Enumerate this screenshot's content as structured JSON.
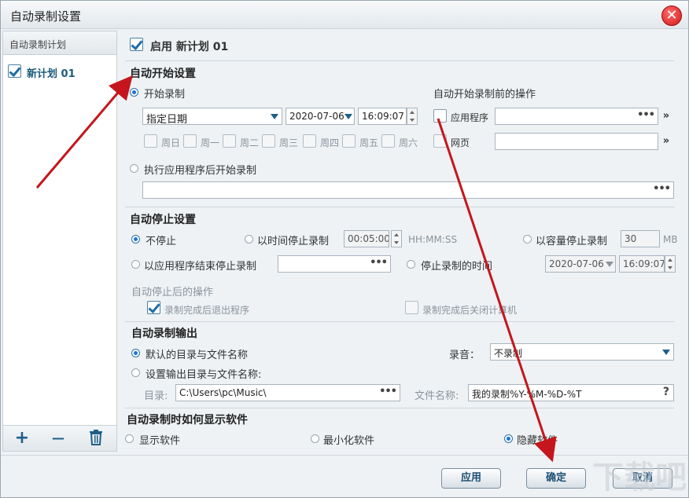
{
  "window": {
    "title": "自动录制设置",
    "close_symbol": "✕"
  },
  "left": {
    "header": "自动录制计划",
    "items": [
      {
        "label": "新计划 01",
        "checked": true
      }
    ]
  },
  "enable_label": "启用 新计划 01",
  "auto_start": {
    "title": "自动开始设置",
    "start_record_label": "开始录制",
    "date_mode": "指定日期",
    "date": "2020-07-06",
    "time": "16:09:07",
    "weekdays": [
      "周日",
      "周一",
      "周二",
      "周三",
      "周四",
      "周五",
      "周六"
    ],
    "after_app_label": "执行应用程序后开始录制",
    "pre_actions_title": "自动开始录制前的操作",
    "app_label": "应用程序",
    "web_label": "网页",
    "dots": "•••",
    "go_symbol": "»"
  },
  "auto_stop": {
    "title": "自动停止设置",
    "no_stop_label": "不停止",
    "by_time_label": "以时间停止录制",
    "time_value": "00:05:00",
    "time_unit": "HH:MM:SS",
    "by_size_label": "以容量停止录制",
    "size_value": "30",
    "size_unit": "MB",
    "by_app_end_label": "以应用程序结束停止录制",
    "stop_time_label": "停止录制的时间",
    "stop_date": "2020-07-06",
    "stop_time": "16:09:07",
    "after_stop_title": "自动停止后的操作",
    "exit_program_label": "录制完成后退出程序",
    "shutdown_label": "录制完成后关闭计算机"
  },
  "output": {
    "title": "自动录制输出",
    "default_label": "默认的目录与文件名称",
    "audio_label": "录音：",
    "audio_value": "不录制",
    "custom_label": "设置输出目录与文件名称:",
    "dir_label": "目录:",
    "dir_value": "C:\\Users\\pc\\Music\\",
    "filename_label": "文件名称:",
    "filename_value": "我的录制%Y-%M-%D-%T",
    "help_symbol": "?"
  },
  "display": {
    "title": "自动录制时如何显示软件",
    "show_label": "显示软件",
    "minimize_label": "最小化软件",
    "hide_label": "隐藏软件"
  },
  "buttons": {
    "apply": "应用",
    "ok": "确定",
    "cancel": "取消"
  },
  "left_toolbar": {
    "add": "+",
    "remove": "—"
  },
  "watermark": "下载吧",
  "colors": {
    "accent": "#1b74d4",
    "arrow": "#c4161c"
  }
}
